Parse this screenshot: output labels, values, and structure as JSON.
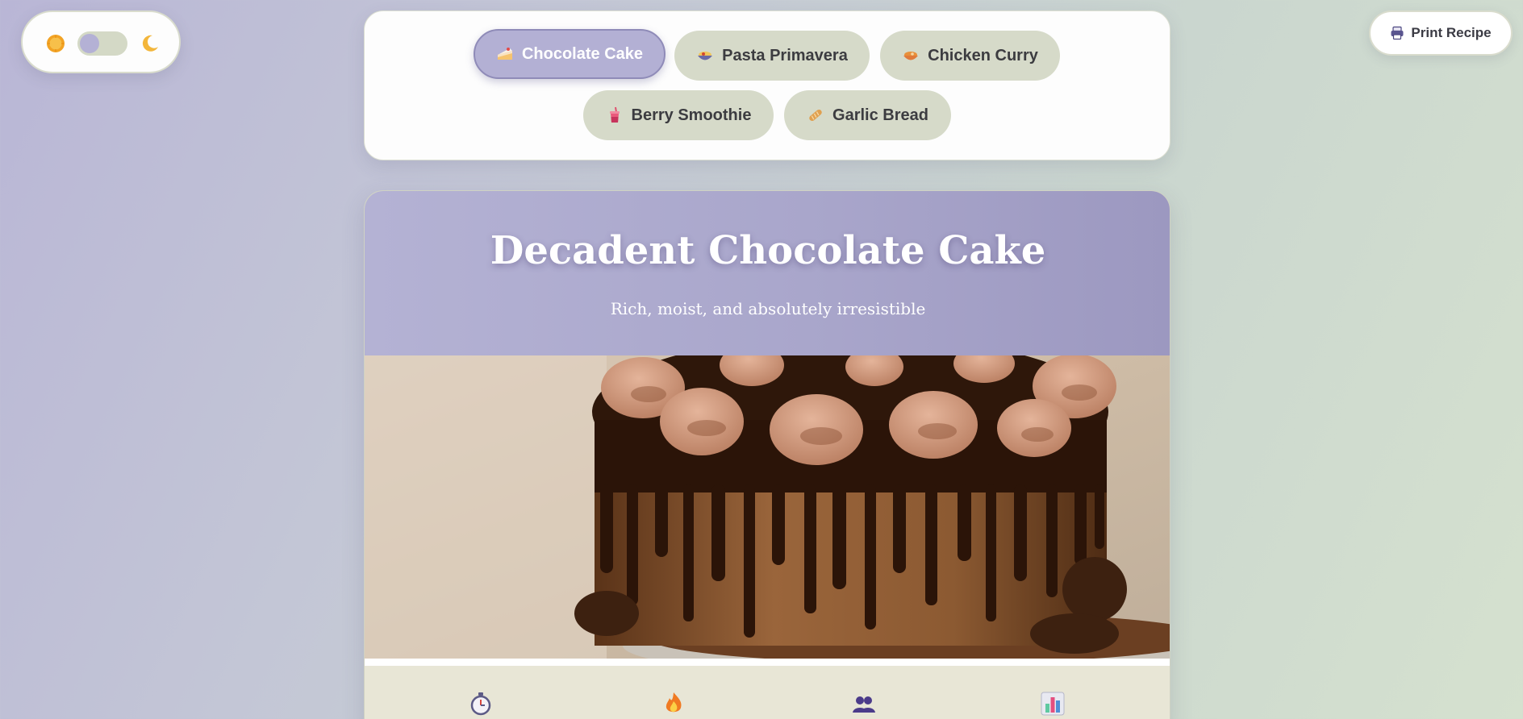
{
  "theme_toggle": {
    "icons": [
      "sun-icon",
      "moon-icon"
    ],
    "mode": "light"
  },
  "print": {
    "label": "Print Recipe",
    "icon": "printer-icon"
  },
  "tabs": [
    {
      "label": "Chocolate Cake",
      "icon": "cake-slice-icon",
      "active": true
    },
    {
      "label": "Pasta Primavera",
      "icon": "pasta-bowl-icon",
      "active": false
    },
    {
      "label": "Chicken Curry",
      "icon": "curry-bowl-icon",
      "active": false
    },
    {
      "label": "Berry Smoothie",
      "icon": "smoothie-cup-icon",
      "active": false
    },
    {
      "label": "Garlic Bread",
      "icon": "bread-icon",
      "active": false
    }
  ],
  "recipe": {
    "title": "Decadent Chocolate Cake",
    "subtitle": "Rich, moist, and absolutely irresistible",
    "image": "chocolate-drip-cake-photo",
    "stat_icons": [
      "stopwatch-icon",
      "fire-icon",
      "people-icon",
      "bar-chart-icon"
    ]
  },
  "colors": {
    "accent": "#b3b0d4",
    "tab_inactive": "#d6dac9",
    "stats_bg": "#e8e6d6"
  }
}
